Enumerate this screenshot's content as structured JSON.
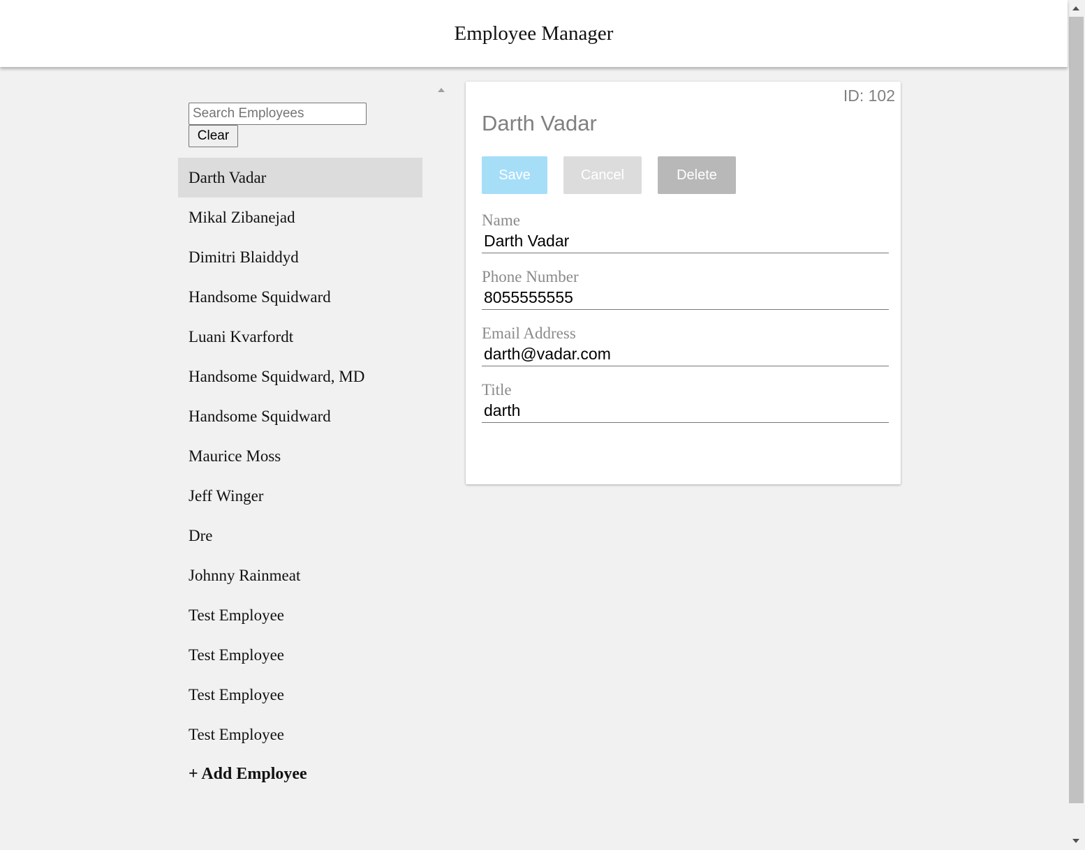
{
  "header": {
    "title": "Employee Manager"
  },
  "search": {
    "placeholder": "Search Employees",
    "value": "",
    "clear_label": "Clear"
  },
  "employees": [
    "Darth Vadar",
    "Mikal Zibanejad",
    "Dimitri Blaiddyd",
    "Handsome Squidward",
    "Luani Kvarfordt",
    "Handsome Squidward, MD",
    "Handsome Squidward",
    "Maurice Moss",
    "Jeff Winger",
    "Dre",
    "Johnny Rainmeat",
    "Test Employee",
    "Test Employee",
    "Test Employee",
    "Test Employee"
  ],
  "selected_index": 0,
  "add_employee_label": "+ Add Employee",
  "detail": {
    "id_label": "ID: 102",
    "name_heading": "Darth Vadar",
    "buttons": {
      "save": "Save",
      "cancel": "Cancel",
      "delete": "Delete"
    },
    "fields": {
      "name": {
        "label": "Name",
        "value": "Darth Vadar"
      },
      "phone": {
        "label": "Phone Number",
        "value": "8055555555"
      },
      "email": {
        "label": "Email Address",
        "value": "darth@vadar.com"
      },
      "title": {
        "label": "Title",
        "value": "darth"
      }
    }
  },
  "colors": {
    "save_button": "#a6def8",
    "cancel_button": "#dcdcdc",
    "delete_button": "#b8b8b8",
    "selected_row": "#dcdcdc",
    "background": "#f1f1f1"
  }
}
